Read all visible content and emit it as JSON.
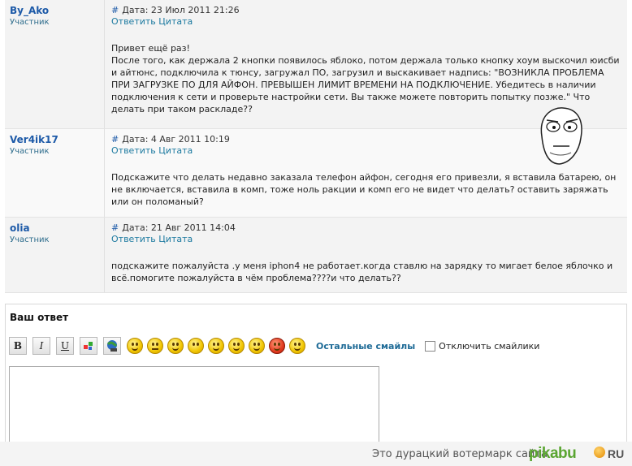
{
  "posts": [
    {
      "author": "By_Ako",
      "role": "Участник",
      "hash": "#",
      "date": "Дата: 23 Июл 2011 21:26",
      "reply": "Ответить",
      "quote": "Цитата",
      "text": "Привет ещё раз!\nПосле того, как держала 2 кнопки появилось яблоко, потом держала только кнопку хоум выскочил юисби и айтюнс, подключила к тюнсу, загружал ПО, загрузил и выскакивает надпись: \"ВОЗНИКЛА ПРОБЛЕМА ПРИ ЗАГРУЗКЕ ПО ДЛЯ АЙФОН. ПРЕВЫШЕН ЛИМИТ ВРЕМЕНИ НА ПОДКЛЮЧЕНИЕ. Убедитесь в наличии подключения к сети и проверьте настройки сети. Вы также можете повторить попытку позже.\" Что делать при таком раскладе??"
    },
    {
      "author": "Ver4ik17",
      "role": "Участник",
      "hash": "#",
      "date": "Дата: 4 Авг 2011 10:19",
      "reply": "Ответить",
      "quote": "Цитата",
      "text": "Подскажите что делать недавно заказала телефон айфон, сегодня его привезли, я вставила батарею, он не включается, вставила в комп, тоже ноль ракции и комп его не видет что делать? оставить заряжать или он поломаный?"
    },
    {
      "author": "olia",
      "role": "Участник",
      "hash": "#",
      "date": "Дата: 21 Авг 2011 14:04",
      "reply": "Ответить",
      "quote": "Цитата",
      "text": "подскажите пожалуйста .у меня iphon4 не работает.когда ставлю на зарядку то мигает белое яблочко и всё.помогите пожалуйста в чём проблема????и что делать??"
    }
  ],
  "reply_form": {
    "title": "Ваш ответ",
    "toolbar": {
      "bold": "B",
      "italic": "I",
      "underline": "U"
    },
    "more_smileys": "Остальные смайлы",
    "disable_smileys": "Отключить смайлики",
    "textarea_value": ""
  },
  "watermark": {
    "text": "Это дурацкий вотермарк сайта",
    "brand": "pikabu",
    "tld": "RU"
  },
  "colors": {
    "link": "#1d5aa8",
    "pikabu": "#5aa531"
  }
}
